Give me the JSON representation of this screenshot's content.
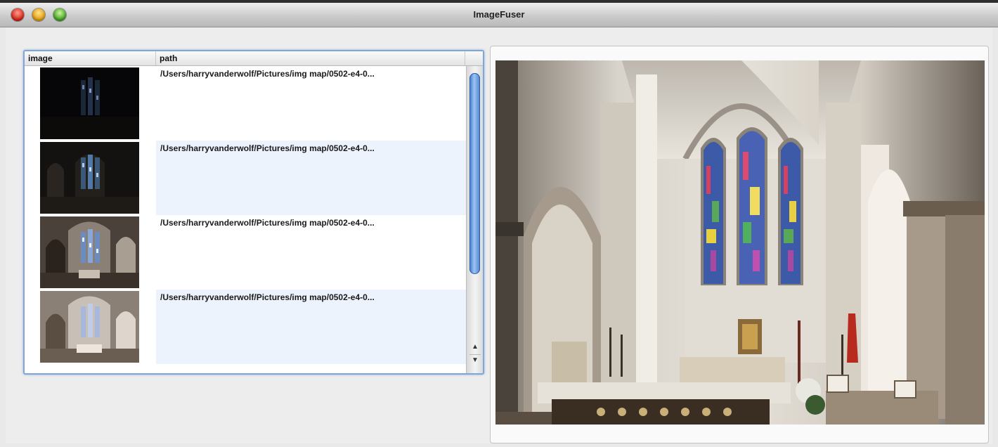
{
  "window": {
    "title": "ImageFuser"
  },
  "table": {
    "columns": {
      "image": "image",
      "path": "path"
    },
    "rows": [
      {
        "path": "/Users/harryvanderwolf/Pictures/img map/0502-e4-0...",
        "thumb": "church-interior-darkest"
      },
      {
        "path": "/Users/harryvanderwolf/Pictures/img map/0502-e4-0...",
        "thumb": "church-interior-dark"
      },
      {
        "path": "/Users/harryvanderwolf/Pictures/img map/0502-e4-0...",
        "thumb": "church-interior-medium"
      },
      {
        "path": "/Users/harryvanderwolf/Pictures/img map/0502-e4-0...",
        "thumb": "church-interior-bright"
      }
    ]
  },
  "preview": {
    "image": "fused-church-interior-preview"
  },
  "colors": {
    "selection_border": "#7ea6d6",
    "alt_row": "#edf3fd",
    "scroll_thumb": "#4b82d5"
  }
}
